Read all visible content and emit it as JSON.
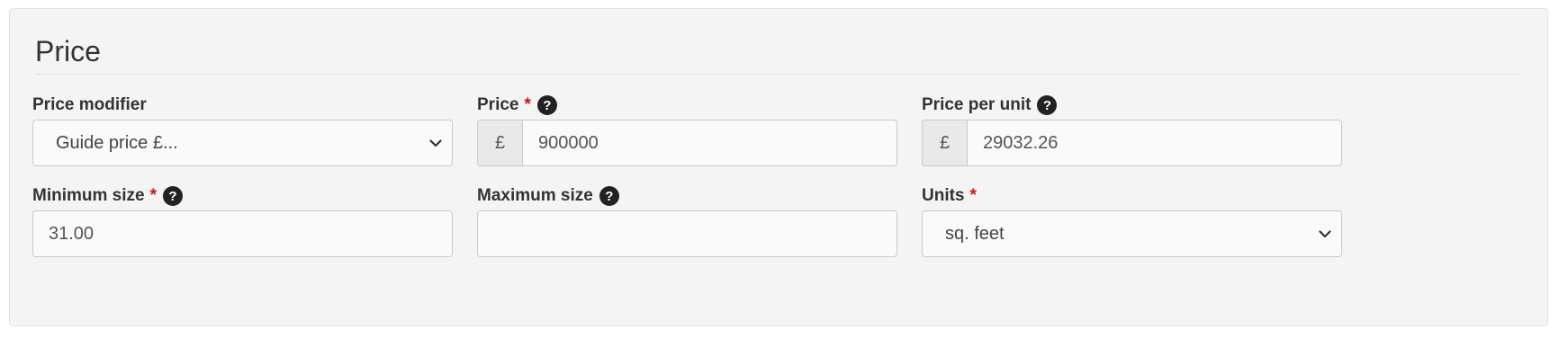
{
  "section": {
    "title": "Price"
  },
  "fields": {
    "price_modifier": {
      "label": "Price modifier",
      "value": "Guide price £..."
    },
    "price": {
      "label": "Price",
      "required_mark": "*",
      "currency": "£",
      "value": "900000"
    },
    "price_per_unit": {
      "label": "Price per unit",
      "currency": "£",
      "value": "29032.26"
    },
    "minimum_size": {
      "label": "Minimum size",
      "required_mark": "*",
      "value": "31.00"
    },
    "maximum_size": {
      "label": "Maximum size",
      "value": ""
    },
    "units": {
      "label": "Units",
      "required_mark": "*",
      "value": "sq. feet"
    }
  },
  "icons": {
    "help": "question-circle-icon",
    "dropdown": "chevron-down-icon"
  },
  "colors": {
    "panel_background": "#f4f4f4",
    "required": "#cc1111",
    "help_icon": "#222222"
  }
}
